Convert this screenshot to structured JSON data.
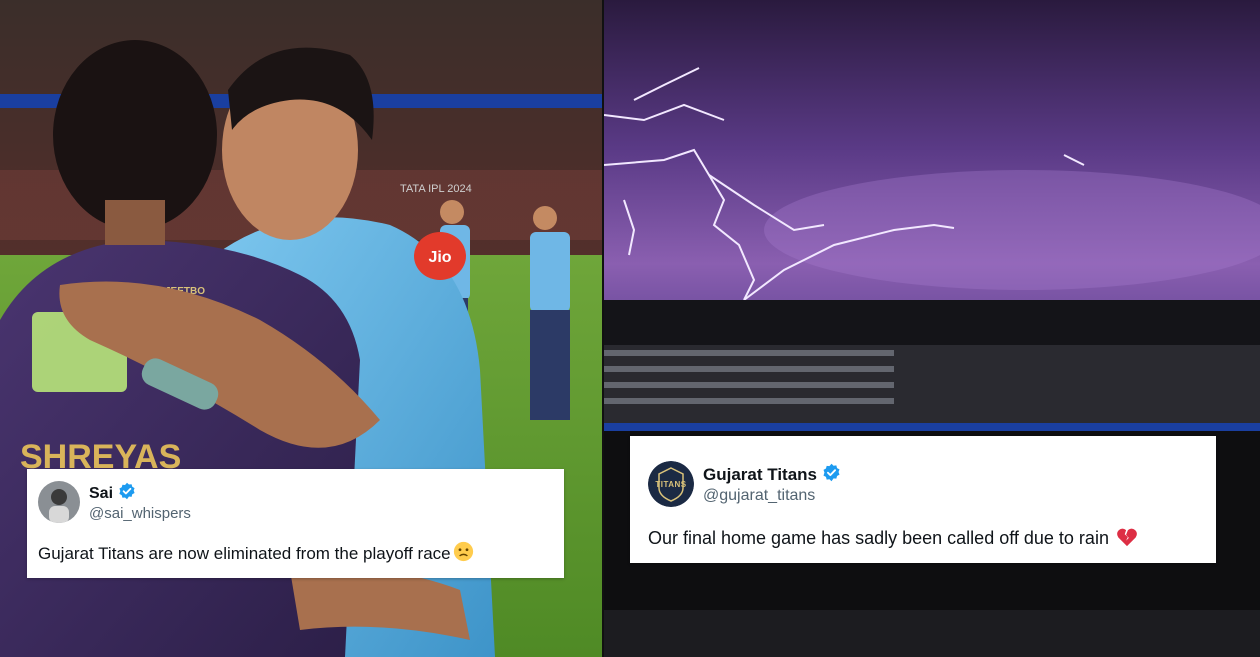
{
  "left_photo": {
    "jersey_text": "SHREYAS",
    "sponsor_jio": "Jio",
    "sponsor_jeetbo": "JEETBO",
    "stadium_board": "TATA IPL 2024"
  },
  "tweet_sai": {
    "display_name": "Sai",
    "handle": "@sai_whispers",
    "text": "Gujarat Titans are now eliminated from the playoff race",
    "emoji": "slightly-frowning-face-icon"
  },
  "tweet_gt": {
    "display_name": "Gujarat Titans",
    "handle": "@gujarat_titans",
    "text": "Our final home game has sadly been called off due to rain",
    "emoji": "broken-heart-icon",
    "avatar_label": "TITANS"
  },
  "colors": {
    "verified": "#1d9bf0",
    "kkr_purple": "#3a2a5c",
    "gt_blue": "#5bb0e0",
    "storm_purple": "#6a4a9a"
  }
}
